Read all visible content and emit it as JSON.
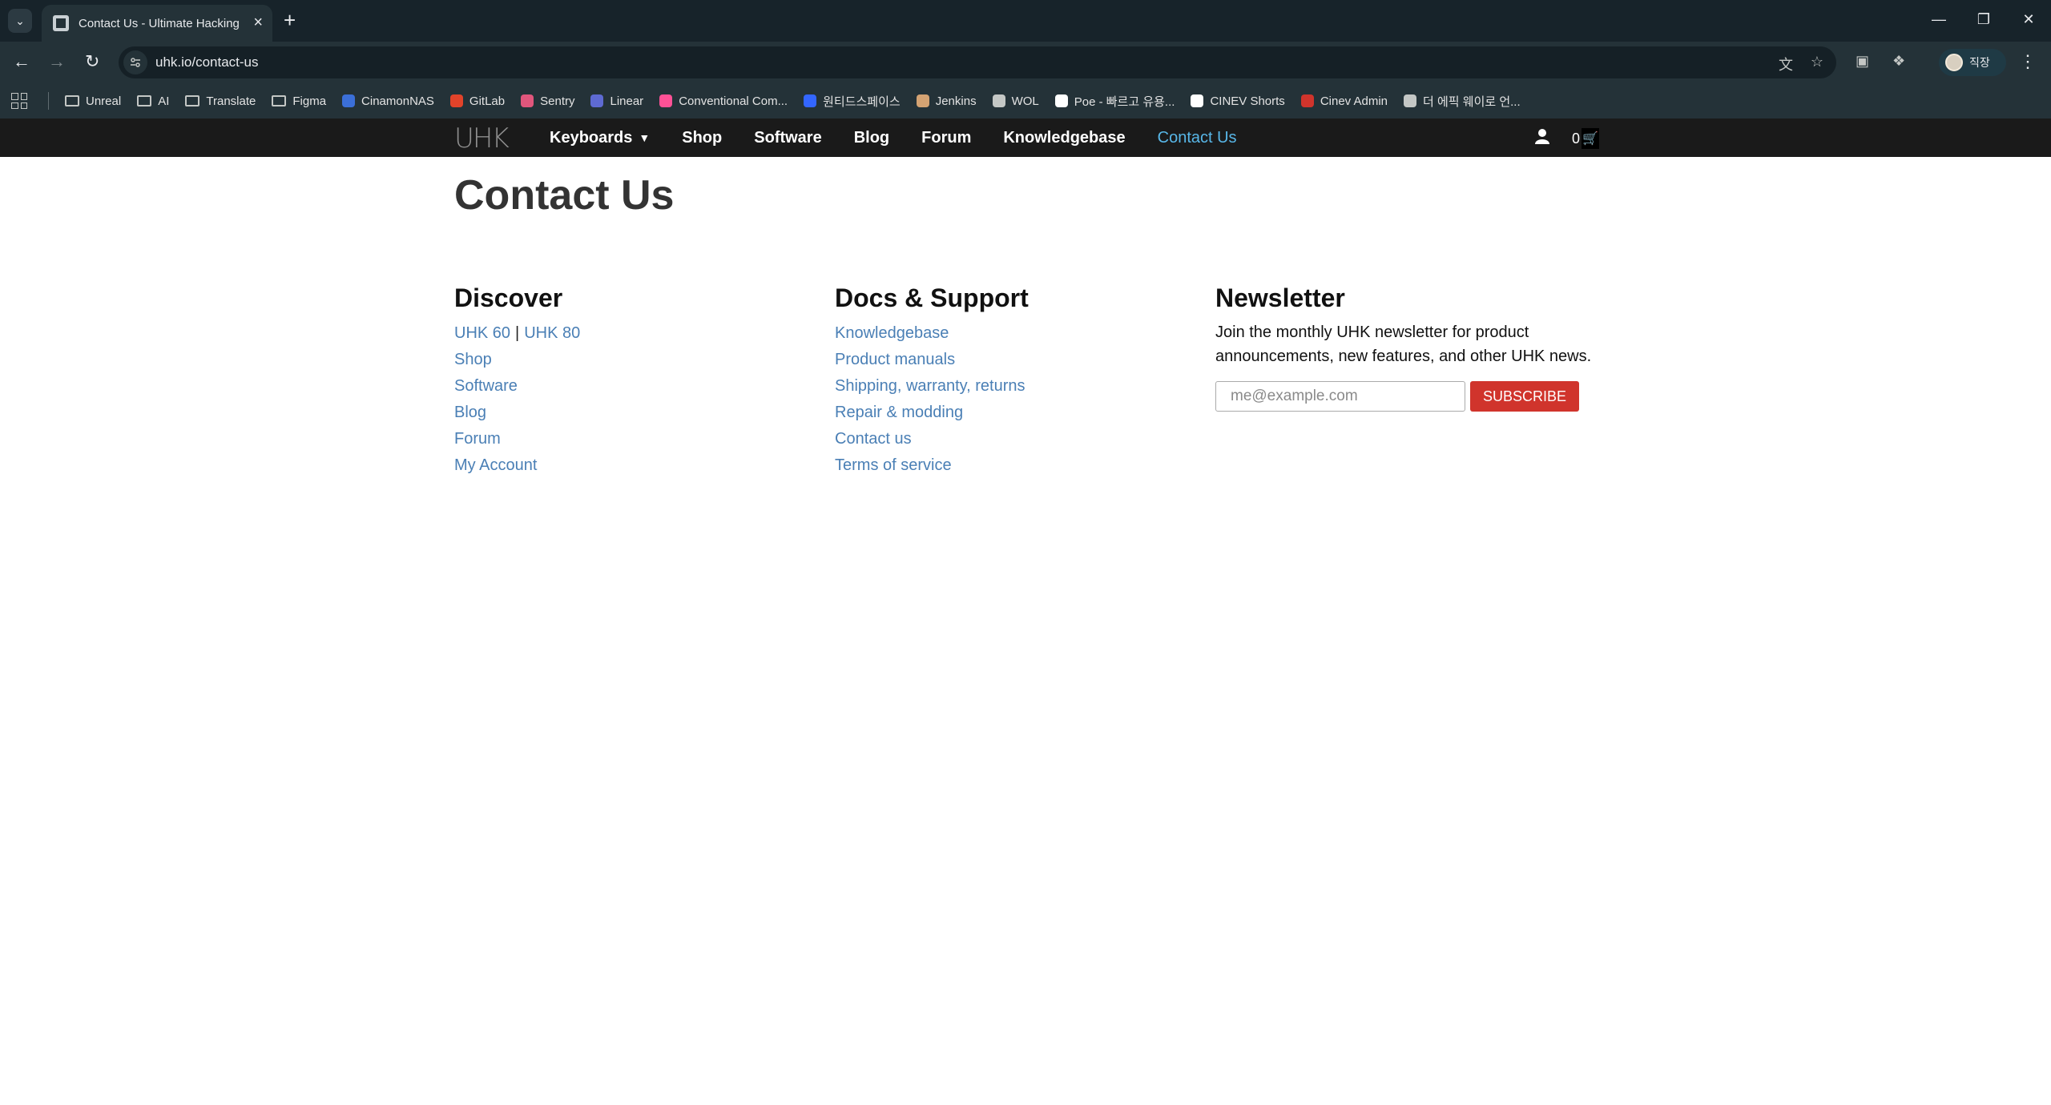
{
  "browser": {
    "tab_title": "Contact Us - Ultimate Hacking",
    "url": "uhk.io/contact-us",
    "profile_name": "직장",
    "bookmarks": [
      {
        "label": "Unreal",
        "icon": "folder-icon"
      },
      {
        "label": "AI",
        "icon": "folder-icon"
      },
      {
        "label": "Translate",
        "icon": "folder-icon"
      },
      {
        "label": "Figma",
        "icon": "folder-icon"
      },
      {
        "label": "CinamonNAS",
        "icon": "nas-icon",
        "color": "#3b6fd8"
      },
      {
        "label": "GitLab",
        "icon": "gitlab-icon",
        "color": "#e2432a"
      },
      {
        "label": "Sentry",
        "icon": "sentry-icon",
        "color": "#e1567c"
      },
      {
        "label": "Linear",
        "icon": "linear-icon",
        "color": "#5e6ad2"
      },
      {
        "label": "Conventional Com...",
        "icon": "conventional-commits-icon",
        "color": "#fe5196"
      },
      {
        "label": "원티드스페이스",
        "icon": "wanted-icon",
        "color": "#3366ff"
      },
      {
        "label": "Jenkins",
        "icon": "jenkins-icon",
        "color": "#d4a373"
      },
      {
        "label": "WOL",
        "icon": "globe-icon",
        "color": "#c4c7c5"
      },
      {
        "label": "Poe - 빠르고 유용...",
        "icon": "poe-icon",
        "color": "#ffffff"
      },
      {
        "label": "CINEV Shorts",
        "icon": "cinev-icon",
        "color": "#ffffff"
      },
      {
        "label": "Cinev Admin",
        "icon": "cinev-admin-icon",
        "color": "#d0342c"
      },
      {
        "label": "더 에픽 웨이로 언...",
        "icon": "page-icon",
        "color": "#c4c7c5"
      }
    ]
  },
  "site_nav": {
    "logo": "UHK",
    "links": [
      {
        "label": "Keyboards",
        "dropdown": true
      },
      {
        "label": "Shop"
      },
      {
        "label": "Software"
      },
      {
        "label": "Blog"
      },
      {
        "label": "Forum"
      },
      {
        "label": "Knowledgebase"
      },
      {
        "label": "Contact Us",
        "active": true
      }
    ],
    "cart_count": "0"
  },
  "page": {
    "title": "Contact Us"
  },
  "discover": {
    "heading": "Discover",
    "uhk60": "UHK 60",
    "separator": "|",
    "uhk80": "UHK 80",
    "links": [
      "Shop",
      "Software",
      "Blog",
      "Forum",
      "My Account"
    ]
  },
  "docs": {
    "heading": "Docs & Support",
    "links": [
      "Knowledgebase",
      "Product manuals",
      "Shipping, warranty, returns",
      "Repair & modding",
      "Contact us",
      "Terms of service"
    ]
  },
  "newsletter": {
    "heading": "Newsletter",
    "text": "Join the monthly UHK newsletter for product announcements, new features, and other UHK news.",
    "placeholder": "me@example.com",
    "button": "SUBSCRIBE"
  },
  "colors": {
    "link": "#4a7fb5",
    "nav_active": "#58b7e8",
    "subscribe": "#d0342c",
    "nav_bg": "#1a1a1a"
  }
}
